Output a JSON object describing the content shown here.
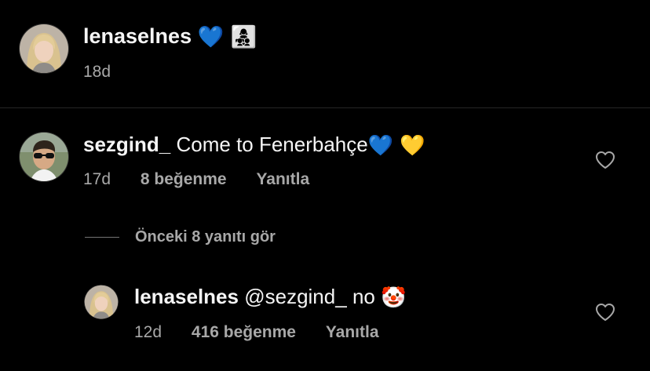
{
  "caption": {
    "username": "lenaselnes",
    "emojis": "💙 👩‍👧‍👦",
    "time": "18d"
  },
  "comments": [
    {
      "username": "sezgind_",
      "text": "Come to Fenerbahçe",
      "emojis": "💙 💛",
      "time": "17d",
      "likes": "8 beğenme",
      "reply_label": "Yanıtla"
    }
  ],
  "view_replies_label": "Önceki 8 yanıtı gör",
  "replies": [
    {
      "username": "lenaselnes",
      "mention": "@sezgind_",
      "text": "no",
      "emojis": "🤡",
      "time": "12d",
      "likes": "416 beğenme",
      "reply_label": "Yanıtla"
    }
  ],
  "icons": {
    "like": "heart-outline-icon",
    "avatar_lena": "avatar-photo",
    "avatar_sezgin": "avatar-photo"
  },
  "colors": {
    "background": "#000000",
    "primary_text": "#f5f5f5",
    "secondary_text": "#a8a8a8",
    "divider": "#262626"
  }
}
